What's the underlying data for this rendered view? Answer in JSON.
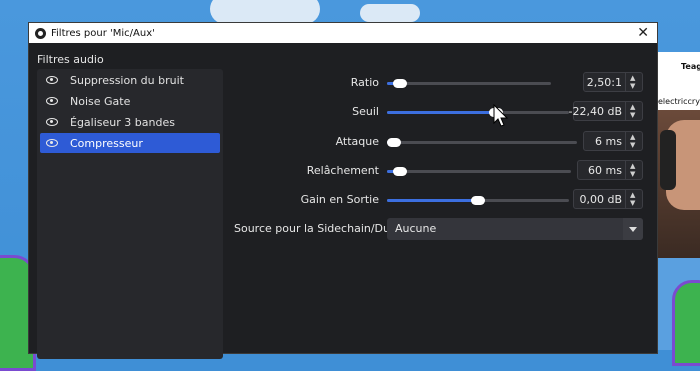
{
  "window": {
    "title": "Filtres pour 'Mic/Aux'",
    "close_glyph": "✕"
  },
  "background": {
    "right_text_1": "Teag",
    "right_text_2": "electriccryst"
  },
  "filters": {
    "label": "Filtres audio",
    "items": [
      {
        "label": "Suppression du bruit",
        "icon": "eye-icon",
        "selected": false
      },
      {
        "label": "Noise Gate",
        "icon": "eye-icon",
        "selected": false
      },
      {
        "label": "Égaliseur 3 bandes",
        "icon": "eye-icon",
        "selected": false
      },
      {
        "label": "Compresseur",
        "icon": "eye-icon",
        "selected": true
      }
    ]
  },
  "properties": [
    {
      "label": "Ratio",
      "value": "2,50:1",
      "level": 0.08
    },
    {
      "label": "Seuil",
      "value": "-22,40 dB",
      "level": 0.6
    },
    {
      "label": "Attaque",
      "value": "6 ms",
      "level": 0.03
    },
    {
      "label": "Relâchement",
      "value": "60 ms",
      "level": 0.07
    },
    {
      "label": "Gain en Sortie",
      "value": "0,00 dB",
      "level": 0.5
    }
  ],
  "sidechain": {
    "label": "Source pour la Sidechain/Ducking",
    "value": "Aucune"
  },
  "colors": {
    "accent": "#2e5bd6",
    "slider_fill": "#3c6fe0",
    "window_bg": "#1e1f22"
  }
}
